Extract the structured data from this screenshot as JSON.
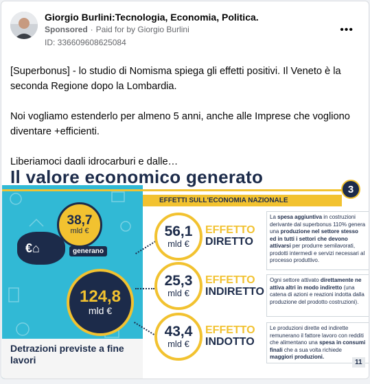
{
  "post": {
    "author": "Giorgio Burlini:Tecnologia, Economia, Politica.",
    "sponsored": "Sponsored",
    "paid_for": "Paid for by Giorgio Burlini",
    "ad_id": "ID: 336609608625084",
    "more_icon": "…",
    "paragraphs": [
      "[Superbonus] - lo studio di Nomisma spiega gli effetti positivi. Il Veneto è la seconda Regione dopo la Lombardia.",
      "Noi vogliamo estenderlo per almeno 5 anni, anche alle Imprese che vogliono diventare +efficienti.",
      "Liberiamoci dagli idrocarburi e dalle…"
    ]
  },
  "infographic": {
    "title": "Il valore economico generato",
    "badge": "3",
    "banner": "EFFETTI SULL'ECONOMIA NAZIONALE",
    "coin_small": {
      "value": "38,7",
      "unit": "mld €"
    },
    "generano": "generano",
    "coin_big": {
      "value": "124,8",
      "unit": "mld €"
    },
    "detrazioni": "Detrazioni previste a fine lavori",
    "effects": [
      {
        "value": "56,1",
        "unit": "mld €",
        "label_a": "EFFETTO",
        "label_b": "DIRETTO",
        "desc_parts": [
          {
            "t": "La ",
            "b": false
          },
          {
            "t": "spesa aggiuntiva",
            "b": true
          },
          {
            "t": " in costruzioni derivante dal superbonus 110% genera una ",
            "b": false
          },
          {
            "t": "produzione nel settore stesso ed in tutti i settori che devono attivarsi",
            "b": true
          },
          {
            "t": " per produrre semilavorati, prodotti intermedi e servizi necessari al processo produttivo.",
            "b": false
          }
        ]
      },
      {
        "value": "25,3",
        "unit": "mld €",
        "label_a": "EFFETTO",
        "label_b": "INDIRETTO",
        "desc_parts": [
          {
            "t": "Ogni settore attivato ",
            "b": false
          },
          {
            "t": "direttamente ne attiva altri in modo indiretto",
            "b": true
          },
          {
            "t": " (una catena di azioni e reazioni indotta dalla produzione del prodotto costruzioni).",
            "b": false
          }
        ]
      },
      {
        "value": "43,4",
        "unit": "mld €",
        "label_a": "EFFETTO",
        "label_b": "INDOTTO",
        "desc_parts": [
          {
            "t": "Le produzioni dirette ed indirette remunerano il fattore lavoro con redditi che alimentano una ",
            "b": false
          },
          {
            "t": "spesa in consumi finali",
            "b": true
          },
          {
            "t": " che a sua volta richiede ",
            "b": false
          },
          {
            "t": "maggiori produzioni.",
            "b": true
          }
        ]
      }
    ],
    "page_number": "11"
  },
  "colors": {
    "navy": "#1c2b4a",
    "yellow": "#f2c230",
    "teal": "#31b9d5",
    "meta_gray": "#65676b"
  }
}
